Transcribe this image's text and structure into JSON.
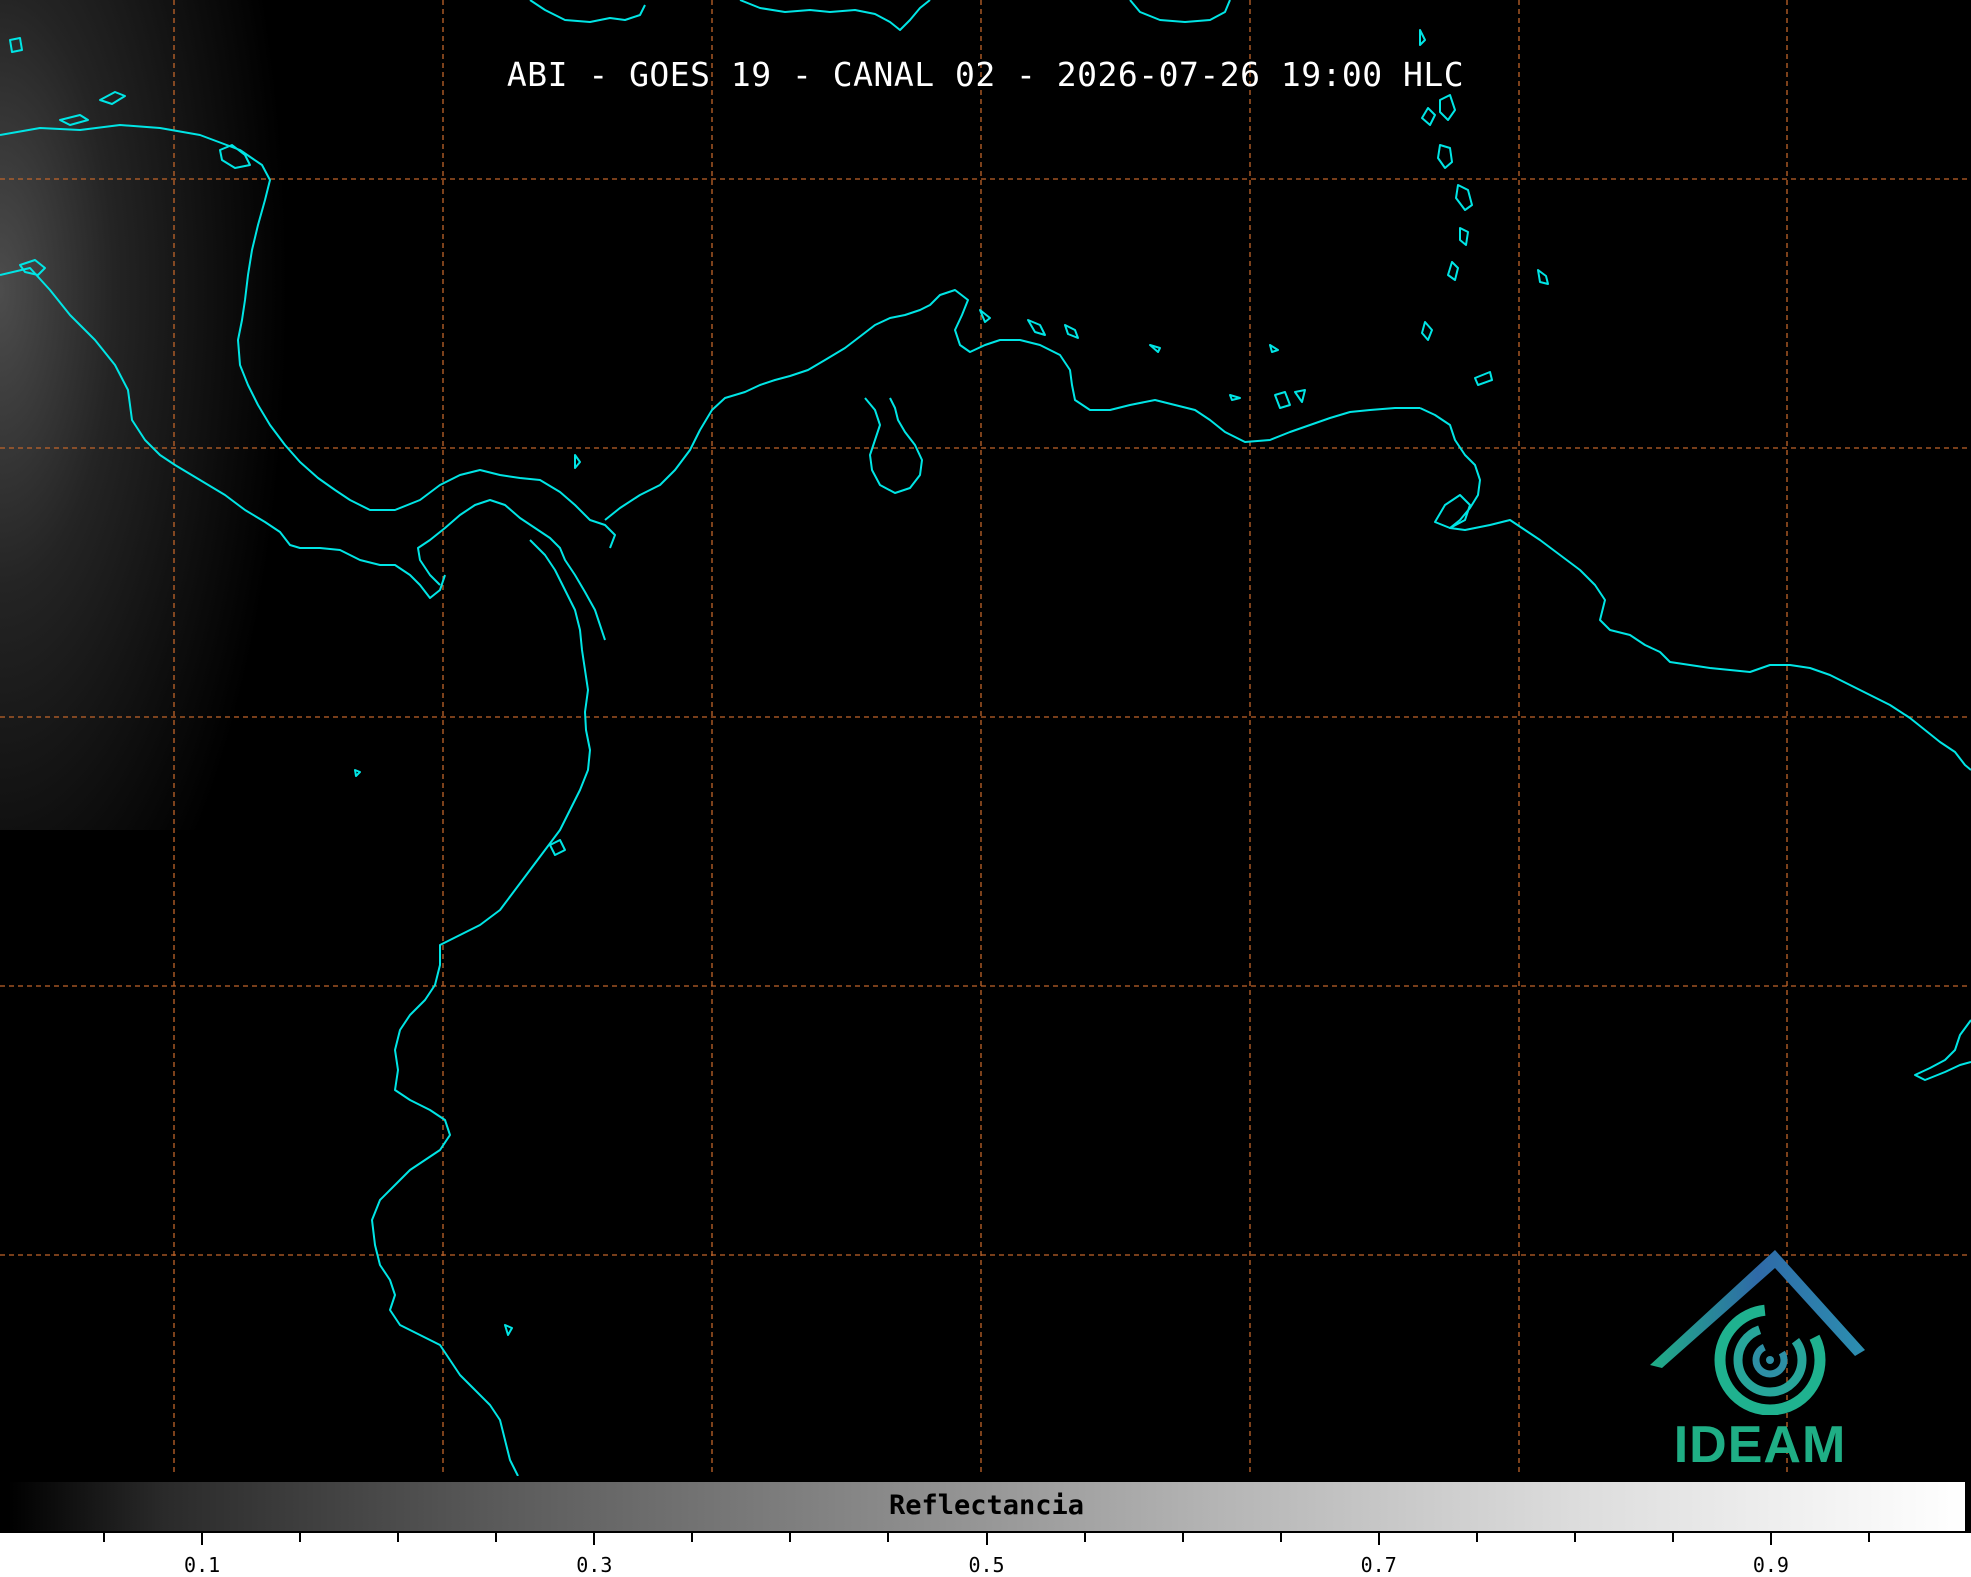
{
  "title": "ABI - GOES 19 - CANAL 02 - 2026-07-26 19:00 HLC",
  "map": {
    "coastline_color": "#00e5e5",
    "gridline_color": "#c0642a",
    "gridline_style": "dashed",
    "background_color": "#000000"
  },
  "colorbar": {
    "label": "Reflectancia",
    "range": [
      0,
      1
    ],
    "tick_labels": [
      {
        "value": 0.1,
        "label": "0.1"
      },
      {
        "value": 0.3,
        "label": "0.3"
      },
      {
        "value": 0.5,
        "label": "0.5"
      },
      {
        "value": 0.7,
        "label": "0.7"
      },
      {
        "value": 0.9,
        "label": "0.9"
      }
    ],
    "colormap": "grayscale"
  },
  "logo": {
    "text": "IDEAM",
    "roof_color": "#2f6aa8",
    "swirl_color": "#1fb28f",
    "text_color": "#1fae85"
  }
}
